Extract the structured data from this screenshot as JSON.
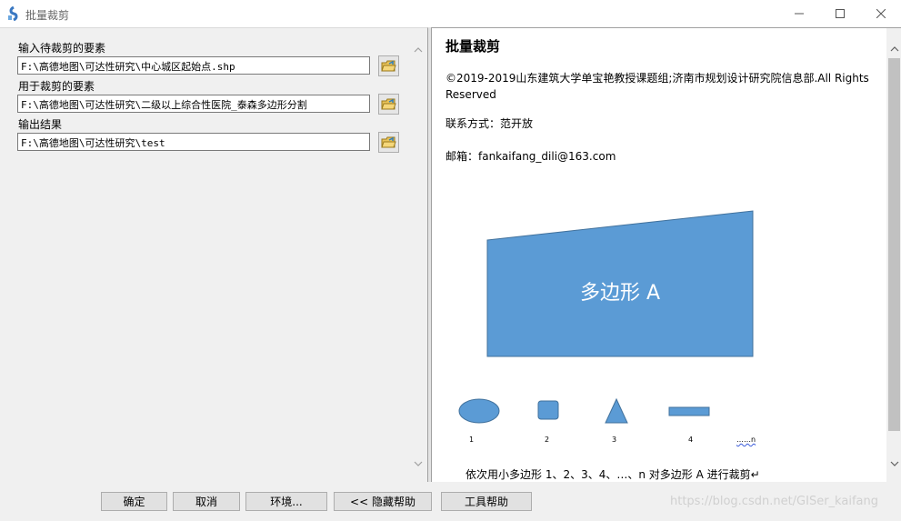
{
  "window": {
    "title": "批量裁剪",
    "minimize_icon": "minimize-icon",
    "maximize_icon": "maximize-icon",
    "close_icon": "close-icon"
  },
  "form": {
    "fields": [
      {
        "label": "输入待裁剪的要素",
        "value": "F:\\高德地图\\可达性研究\\中心城区起始点.shp"
      },
      {
        "label": "用于裁剪的要素",
        "value": "F:\\高德地图\\可达性研究\\二级以上综合性医院_泰森多边形分割"
      },
      {
        "label": "输出结果",
        "value": "F:\\高德地图\\可达性研究\\test"
      }
    ],
    "browse_icon": "open-folder-icon"
  },
  "help": {
    "title": "批量裁剪",
    "copyright": "©2019-2019山东建筑大学单宝艳教授课题组;济南市规划设计研究院信息部.All Rights Reserved",
    "contact": "联系方式：范开放",
    "email": "邮箱：fankaifang_dili@163.com",
    "polygon_label": "多边形 A",
    "shape_labels": [
      "1",
      "2",
      "3",
      "4",
      "……n"
    ],
    "caption": "依次用小多边形 1、2、3、4、…、n 对多边形 A 进行裁剪↵",
    "shape_color": "#5b9bd5"
  },
  "buttons": {
    "ok": "确定",
    "cancel": "取消",
    "env": "环境...",
    "hide_help": "<< 隐藏帮助",
    "tool_help": "工具帮助"
  },
  "watermark": "https://blog.csdn.net/GISer_kaifang"
}
